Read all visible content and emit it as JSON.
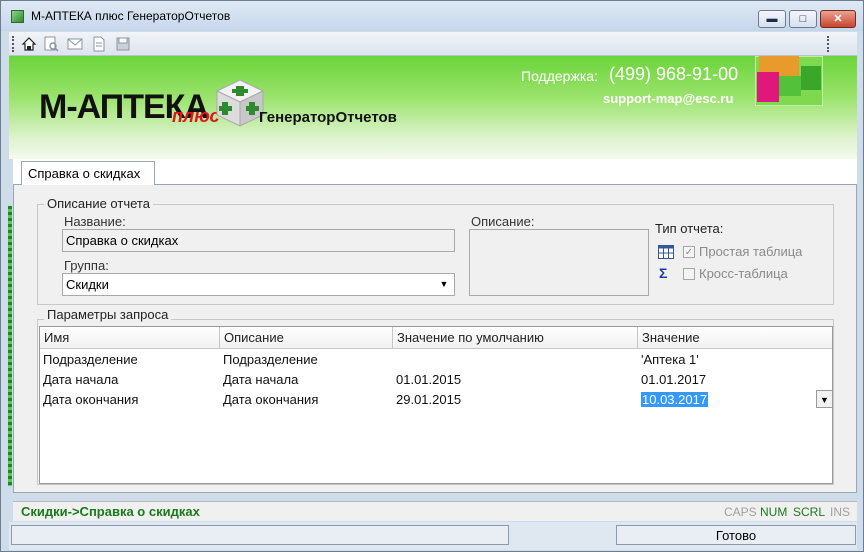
{
  "window": {
    "title": "М-АПТЕКА плюс ГенераторОтчетов",
    "min": "▬",
    "max": "□",
    "close": "✕"
  },
  "toolbar": {
    "icons": [
      "home-icon",
      "preview-icon",
      "email-icon",
      "document-icon",
      "save-icon"
    ]
  },
  "banner": {
    "logo_main": "М-АПТЕКА",
    "logo_plus": "плюс",
    "logo_sub": "ГенераторОтчетов",
    "support_label": "Поддержка:",
    "support_phone": "(499) 968-91-00",
    "support_email": "support-map@esc.ru"
  },
  "tab": {
    "label": "Справка о скидках"
  },
  "report_description": {
    "legend": "Описание отчета",
    "name_label": "Название:",
    "name_value": "Справка о скидках",
    "group_label": "Группа:",
    "group_value": "Скидки",
    "description_label": "Описание:",
    "description_value": "",
    "type_label": "Тип отчета:",
    "type_simple": "Простая таблица",
    "type_simple_checked": true,
    "type_cross": "Кросс-таблица",
    "type_cross_checked": false
  },
  "params": {
    "legend": "Параметры запроса",
    "columns": [
      "Имя",
      "Описание",
      "Значение по умолчанию",
      "Значение"
    ],
    "rows": [
      {
        "name": "Подразделение",
        "description": "Подразделение",
        "default": "",
        "value": "'Аптека 1'"
      },
      {
        "name": "Дата начала",
        "description": "Дата начала",
        "default": "01.01.2015",
        "value": "01.01.2017"
      },
      {
        "name": "Дата окончания",
        "description": "Дата окончания",
        "default": "29.01.2015",
        "value": "10.03.2017"
      }
    ]
  },
  "status": {
    "path": "Скидки->Справка о скидках",
    "caps": "CAPS",
    "num": "NUM",
    "scrl": "SCRL",
    "ins": "INS",
    "ready": "Готово"
  },
  "colors": {
    "accent_green": "#6bd43a",
    "status_green": "#1b7a1b",
    "selection": "#3399ff"
  }
}
